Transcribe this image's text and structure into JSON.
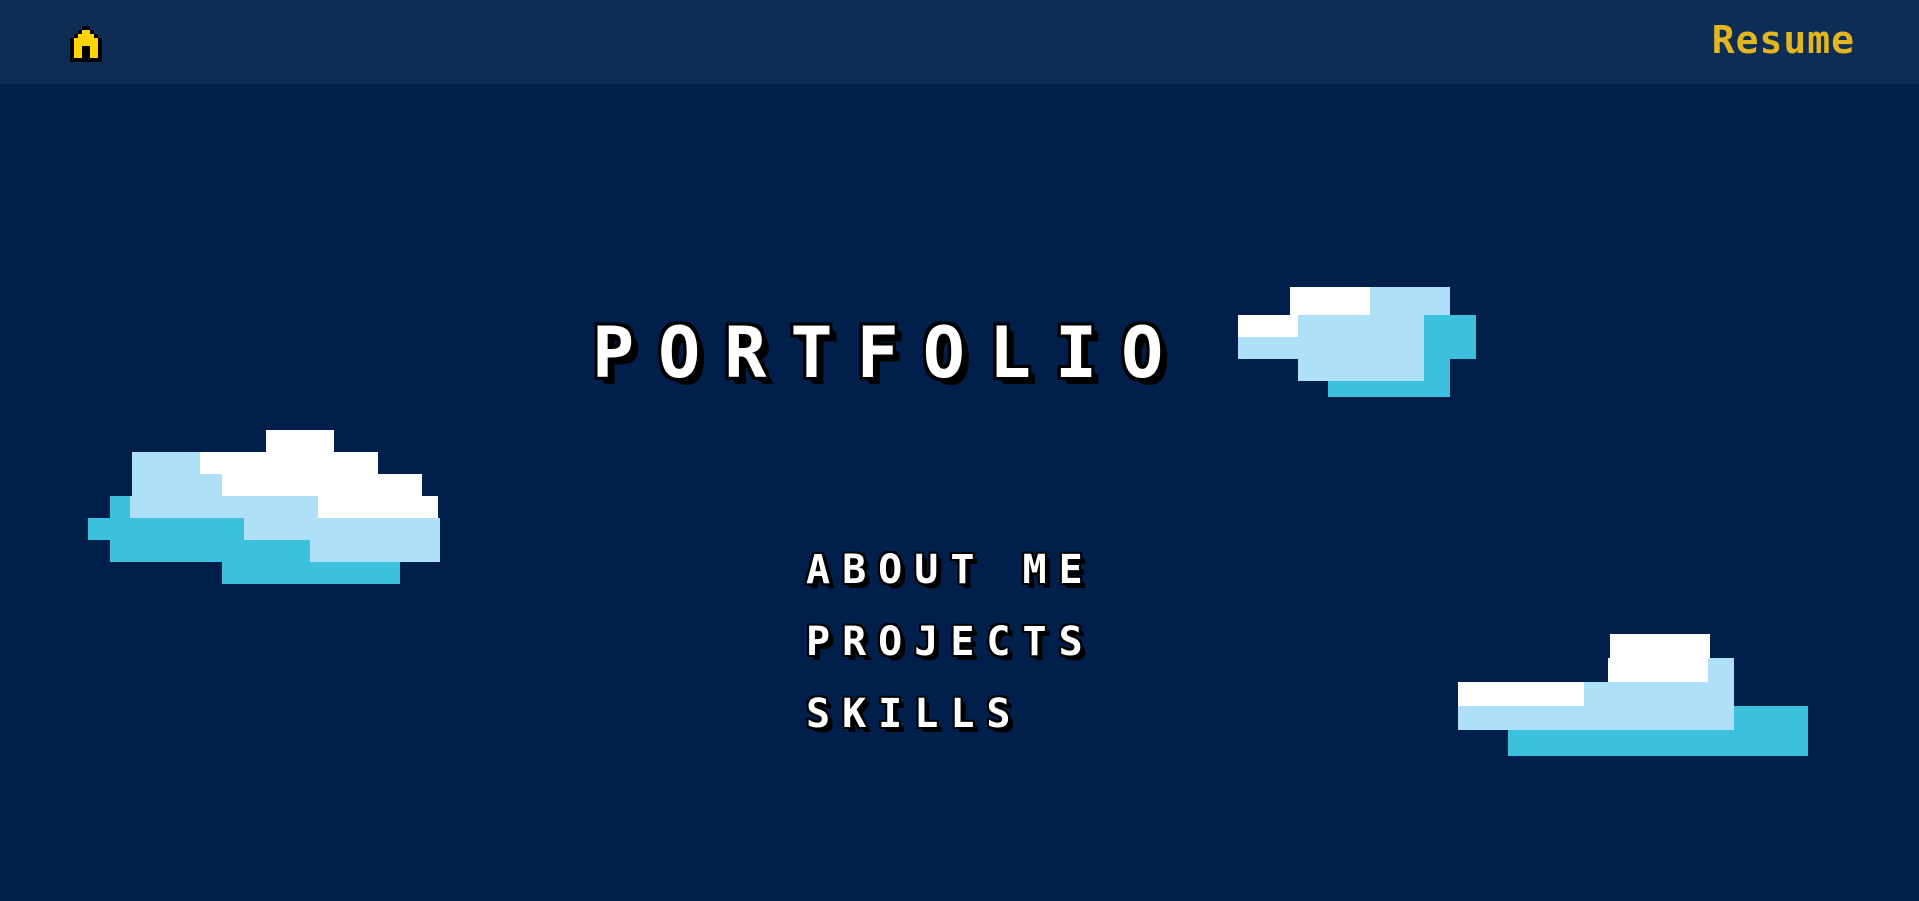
{
  "nav": {
    "home_icon": "home-icon",
    "resume_label": "Resume"
  },
  "hero": {
    "title": "PORTFOLIO"
  },
  "menu": {
    "items": [
      {
        "label": "ABOUT ME"
      },
      {
        "label": "PROJECTS"
      },
      {
        "label": "SKILLS"
      }
    ]
  },
  "colors": {
    "background": "#001f4a",
    "topbar": "#0d2d55",
    "accent": "#e3b51e",
    "cloud_white": "#ffffff",
    "cloud_light": "#aee0f8",
    "cloud_mid": "#3bc1dc"
  }
}
